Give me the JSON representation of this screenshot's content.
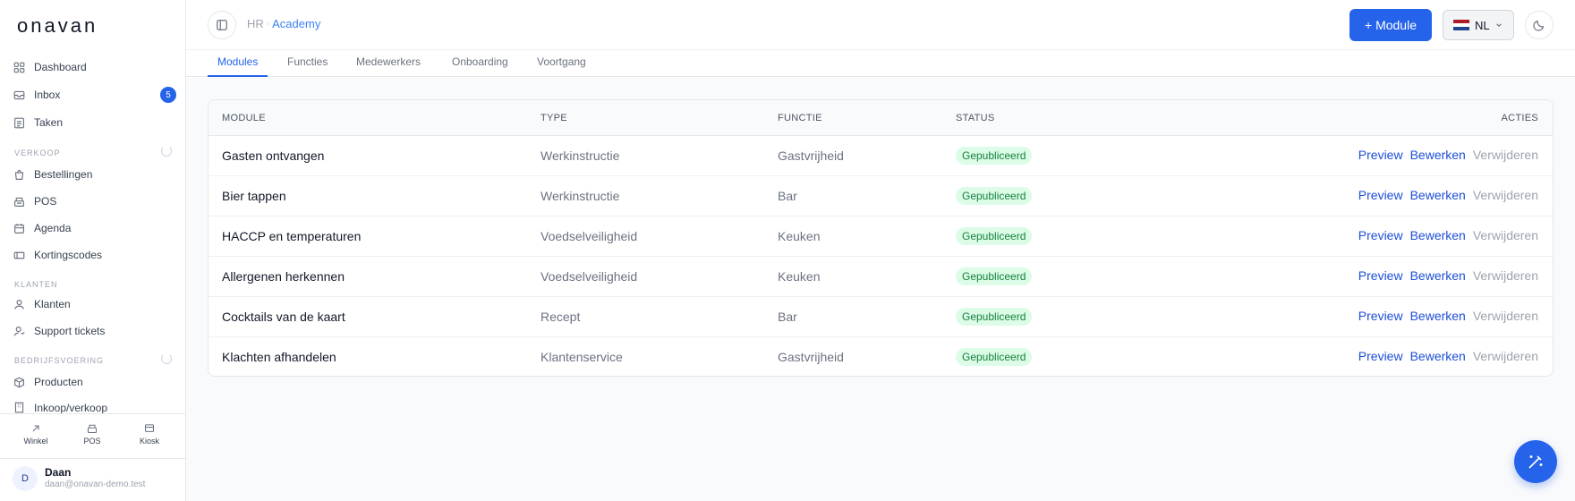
{
  "brand": "onavan",
  "sidebar": {
    "top_items": [
      {
        "label": "Dashboard",
        "icon": "grid-icon"
      },
      {
        "label": "Inbox",
        "icon": "inbox-icon",
        "badge": "5"
      },
      {
        "label": "Taken",
        "icon": "tasks-icon"
      }
    ],
    "sections": [
      {
        "title": "VERKOOP",
        "items": [
          {
            "label": "Bestellingen",
            "icon": "bag-icon"
          },
          {
            "label": "POS",
            "icon": "register-icon"
          },
          {
            "label": "Agenda",
            "icon": "calendar-icon"
          },
          {
            "label": "Kortingscodes",
            "icon": "ticket-icon"
          }
        ]
      },
      {
        "title": "KLANTEN",
        "items": [
          {
            "label": "Klanten",
            "icon": "user-icon"
          },
          {
            "label": "Support tickets",
            "icon": "support-icon"
          }
        ]
      },
      {
        "title": "BEDRIJFSVOERING",
        "items": [
          {
            "label": "Producten",
            "icon": "box-icon"
          },
          {
            "label": "Inkoop/verkoop",
            "icon": "building-icon"
          }
        ]
      }
    ],
    "bottom_links": [
      {
        "label": "Winkel",
        "icon": "external-link-icon"
      },
      {
        "label": "POS",
        "icon": "register-icon"
      },
      {
        "label": "Kiosk",
        "icon": "kiosk-icon"
      }
    ],
    "user": {
      "initial": "D",
      "name": "Daan",
      "email": "daan@onavan-demo.test"
    }
  },
  "header": {
    "breadcrumb": [
      "HR",
      "Academy"
    ],
    "add_button": "+ Module",
    "language": "NL",
    "colors": {
      "accent": "#2563eb"
    }
  },
  "tabs": [
    {
      "label": "Modules",
      "active": true
    },
    {
      "label": "Functies",
      "active": false
    },
    {
      "label": "Medewerkers",
      "active": false
    },
    {
      "label": "Onboarding",
      "active": false
    },
    {
      "label": "Voortgang",
      "active": false
    }
  ],
  "table": {
    "headers": {
      "module": "MODULE",
      "type": "TYPE",
      "functie": "FUNCTIE",
      "status": "STATUS",
      "acties": "ACTIES"
    },
    "actions": {
      "preview": "Preview",
      "edit": "Bewerken",
      "delete": "Verwijderen"
    },
    "rows": [
      {
        "module": "Gasten ontvangen",
        "type": "Werkinstructie",
        "functie": "Gastvrijheid",
        "status": "Gepubliceerd"
      },
      {
        "module": "Bier tappen",
        "type": "Werkinstructie",
        "functie": "Bar",
        "status": "Gepubliceerd"
      },
      {
        "module": "HACCP en temperaturen",
        "type": "Voedselveiligheid",
        "functie": "Keuken",
        "status": "Gepubliceerd"
      },
      {
        "module": "Allergenen herkennen",
        "type": "Voedselveiligheid",
        "functie": "Keuken",
        "status": "Gepubliceerd"
      },
      {
        "module": "Cocktails van de kaart",
        "type": "Recept",
        "functie": "Bar",
        "status": "Gepubliceerd"
      },
      {
        "module": "Klachten afhandelen",
        "type": "Klantenservice",
        "functie": "Gastvrijheid",
        "status": "Gepubliceerd"
      }
    ]
  }
}
